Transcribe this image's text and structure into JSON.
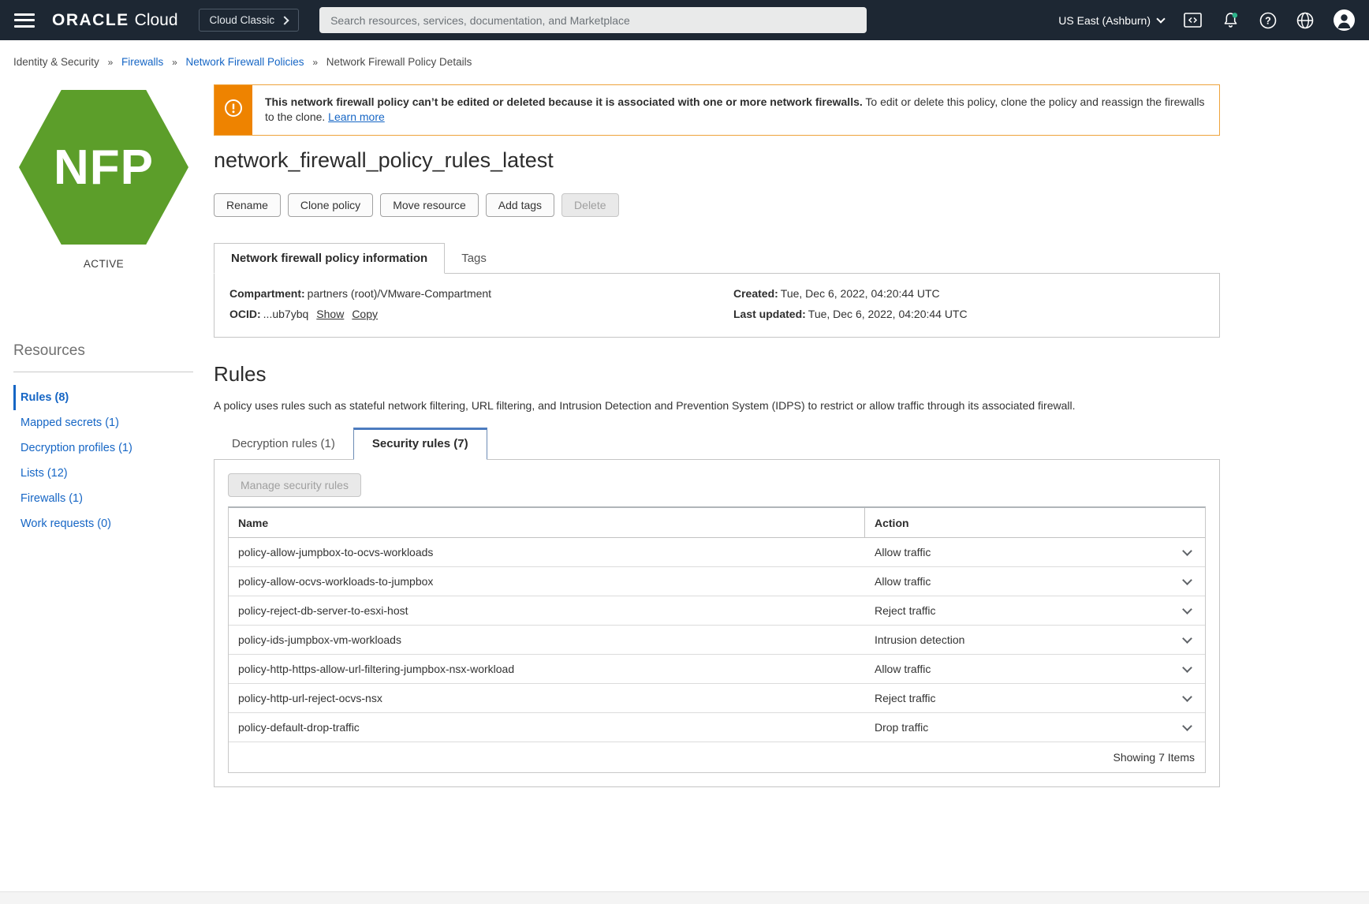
{
  "topbar": {
    "brand_bold": "ORACLE",
    "brand_light": "Cloud",
    "cloud_classic": "Cloud Classic",
    "search_placeholder": "Search resources, services, documentation, and Marketplace",
    "region": "US East (Ashburn)"
  },
  "breadcrumb": {
    "separator": "»",
    "items": [
      {
        "label": "Identity & Security"
      },
      {
        "label": "Firewalls"
      },
      {
        "label": "Network Firewall Policies"
      },
      {
        "label": "Network Firewall Policy Details"
      }
    ]
  },
  "status_badge": {
    "label": "NFP",
    "status": "ACTIVE"
  },
  "sidebar": {
    "title": "Resources",
    "items": [
      {
        "label": "Rules (8)"
      },
      {
        "label": "Mapped secrets (1)"
      },
      {
        "label": "Decryption profiles (1)"
      },
      {
        "label": "Lists (12)"
      },
      {
        "label": "Firewalls (1)"
      },
      {
        "label": "Work requests (0)"
      }
    ]
  },
  "banner": {
    "bold": "This network firewall policy can’t be edited or deleted because it is associated with one or more network firewalls.",
    "text": " To edit or delete this policy, clone the policy and reassign the firewalls to the clone. ",
    "link": "Learn more"
  },
  "page": {
    "title": "network_firewall_policy_rules_latest"
  },
  "actions": {
    "rename": "Rename",
    "clone": "Clone policy",
    "move": "Move resource",
    "add_tags": "Add tags",
    "delete": "Delete"
  },
  "info": {
    "tabs": {
      "info": "Network firewall policy information",
      "tags": "Tags"
    },
    "compartment_label": "Compartment:",
    "compartment_value": "partners (root)/VMware-Compartment",
    "ocid_label": "OCID:",
    "ocid_value": "...ub7ybq",
    "show_link": "Show",
    "copy_link": "Copy",
    "created_label": "Created:",
    "created_value": "Tue, Dec 6, 2022, 04:20:44 UTC",
    "updated_label": "Last updated:",
    "updated_value": "Tue, Dec 6, 2022, 04:20:44 UTC"
  },
  "rules": {
    "heading": "Rules",
    "description": "A policy uses rules such as stateful network filtering, URL filtering, and Intrusion Detection and Prevention System (IDPS) to restrict or allow traffic through its associated firewall.",
    "tabs": {
      "decryption": "Decryption rules (1)",
      "security": "Security rules (7)"
    },
    "manage_button": "Manage security rules",
    "table": {
      "headers": {
        "name": "Name",
        "action": "Action"
      },
      "rows": [
        {
          "name": "policy-allow-jumpbox-to-ocvs-workloads",
          "action": "Allow traffic"
        },
        {
          "name": "policy-allow-ocvs-workloads-to-jumpbox",
          "action": "Allow traffic"
        },
        {
          "name": "policy-reject-db-server-to-esxi-host",
          "action": "Reject traffic"
        },
        {
          "name": "policy-ids-jumpbox-vm-workloads",
          "action": "Intrusion detection"
        },
        {
          "name": "policy-http-https-allow-url-filtering-jumpbox-nsx-workload",
          "action": "Allow traffic"
        },
        {
          "name": "policy-http-url-reject-ocvs-nsx",
          "action": "Reject traffic"
        },
        {
          "name": "policy-default-drop-traffic",
          "action": "Drop traffic"
        }
      ],
      "footer": "Showing 7 Items"
    }
  },
  "colors": {
    "topbar_bg": "#1D2733",
    "link_blue": "#1666C5",
    "warning_orange": "#EE8300",
    "status_active_green": "#5C9E2A",
    "notification_dot_teal": "#2EB58C",
    "active_tab_border_blue": "#4C7BBF"
  }
}
